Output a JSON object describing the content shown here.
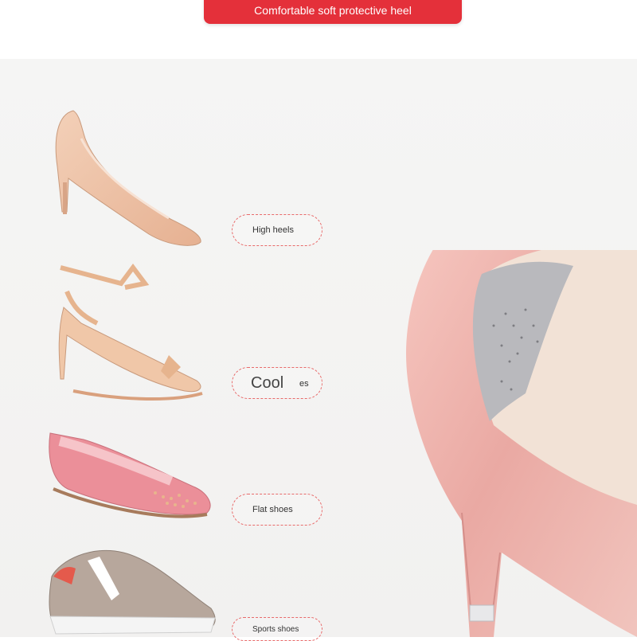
{
  "banner": {
    "title": "Comfortable soft protective heel"
  },
  "categories": [
    {
      "label": "High heels"
    },
    {
      "label": "Cool",
      "partial_tail": "es"
    },
    {
      "label": "Flat shoes"
    },
    {
      "label": "Sports shoes"
    }
  ],
  "colors": {
    "banner_red": "#e4303a",
    "pill_border": "#e86a6a",
    "background": "#f3f2f1",
    "nude": "#eab99c",
    "pink": "#eb8f99",
    "taupe": "#b7a79c"
  }
}
